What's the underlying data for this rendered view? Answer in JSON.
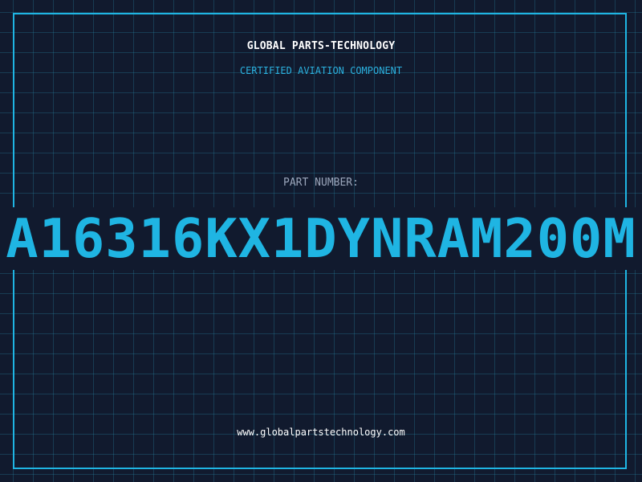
{
  "header": {
    "title": "GLOBAL PARTS-TECHNOLOGY",
    "subtitle": "CERTIFIED AVIATION COMPONENT"
  },
  "part": {
    "label": "PART NUMBER:",
    "value": "A16316KX1DYNRAM200M"
  },
  "footer": {
    "url": "www.globalpartstechnology.com"
  },
  "colors": {
    "background": "#111a2e",
    "grid": "#1f5f78",
    "accent": "#1fb5e3",
    "label": "#9ba6bb",
    "text": "#ffffff"
  }
}
